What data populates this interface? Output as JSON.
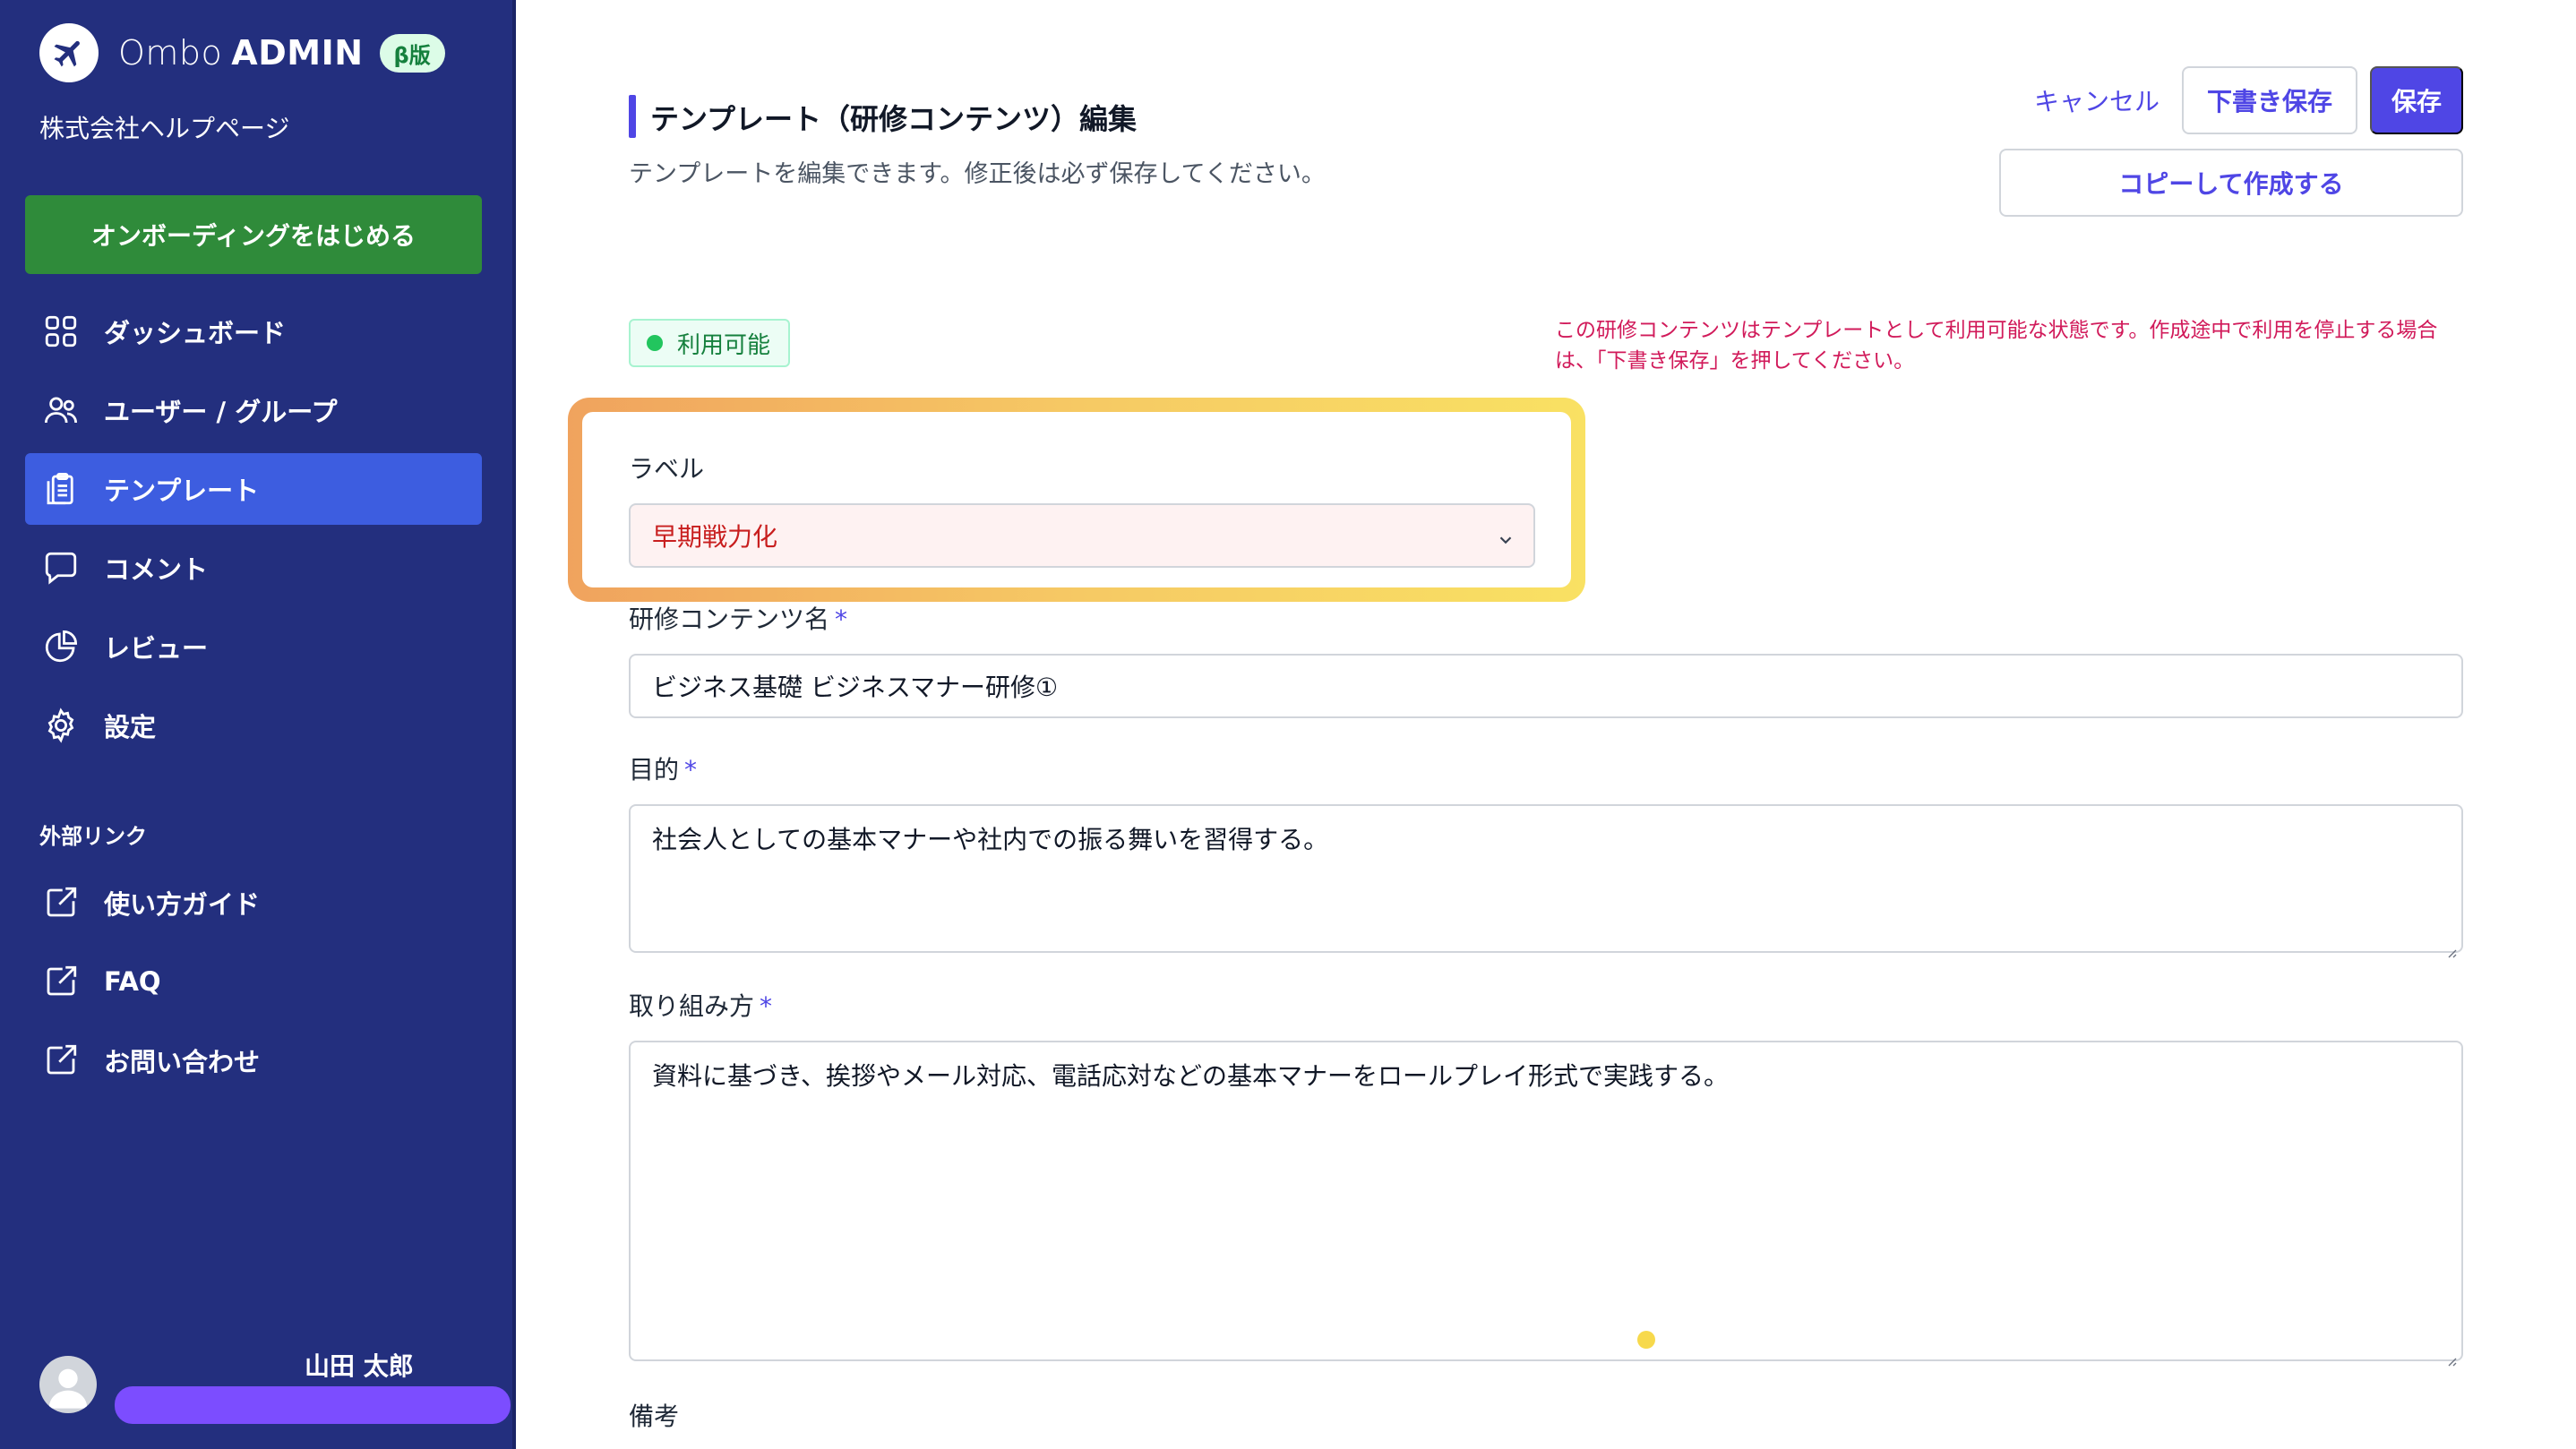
{
  "sidebar": {
    "brand": {
      "name_light": "Ombo",
      "name_bold": "ADMIN",
      "badge": "β版"
    },
    "company": "株式会社ヘルプページ",
    "onboarding_button": "オンボーディングをはじめる",
    "nav": [
      {
        "label": "ダッシュボード",
        "icon": "dashboard-grid-icon"
      },
      {
        "label": "ユーザー / グループ",
        "icon": "users-icon"
      },
      {
        "label": "テンプレート",
        "icon": "clipboard-icon",
        "active": true
      },
      {
        "label": "コメント",
        "icon": "comment-icon"
      },
      {
        "label": "レビュー",
        "icon": "pie-chart-icon"
      },
      {
        "label": "設定",
        "icon": "gear-icon"
      }
    ],
    "external_section_title": "外部リンク",
    "external_links": [
      {
        "label": "使い方ガイド",
        "icon": "external-link-icon"
      },
      {
        "label": "FAQ",
        "icon": "external-link-icon"
      },
      {
        "label": "お問い合わせ",
        "icon": "external-link-icon"
      }
    ],
    "user": {
      "name": "山田 太郎"
    }
  },
  "header": {
    "title": "テンプレート（研修コンテンツ）編集",
    "description": "テンプレートを編集できます。修正後は必ず保存してください。",
    "cancel_label": "キャンセル",
    "draft_label": "下書き保存",
    "save_label": "保存",
    "copy_label": "コピーして作成する"
  },
  "status": {
    "label": "利用可能",
    "note": "この研修コンテンツはテンプレートとして利用可能な状態です。作成途中で利用を停止する場合は、「下書き保存」を押してください。"
  },
  "form": {
    "label_field": {
      "label": "ラベル",
      "value": "早期戦力化"
    },
    "name_field": {
      "label": "研修コンテンツ名",
      "required_mark": "*",
      "value": "ビジネス基礎 ビジネスマナー研修①"
    },
    "purpose_field": {
      "label": "目的",
      "required_mark": "*",
      "value": "社会人としての基本マナーや社内での振る舞いを習得する。"
    },
    "approach_field": {
      "label": "取り組み方",
      "required_mark": "*",
      "value": "資料に基づき、挨拶やメール対応、電話応対などの基本マナーをロールプレイ形式で実践する。"
    },
    "notes_field": {
      "label": "備考"
    }
  },
  "colors": {
    "sidebar_bg": "#232f7e",
    "active_nav": "#3d5de0",
    "accent": "#4f46e5",
    "onboarding": "#2f8b3a",
    "status_note": "#d11a5a"
  }
}
